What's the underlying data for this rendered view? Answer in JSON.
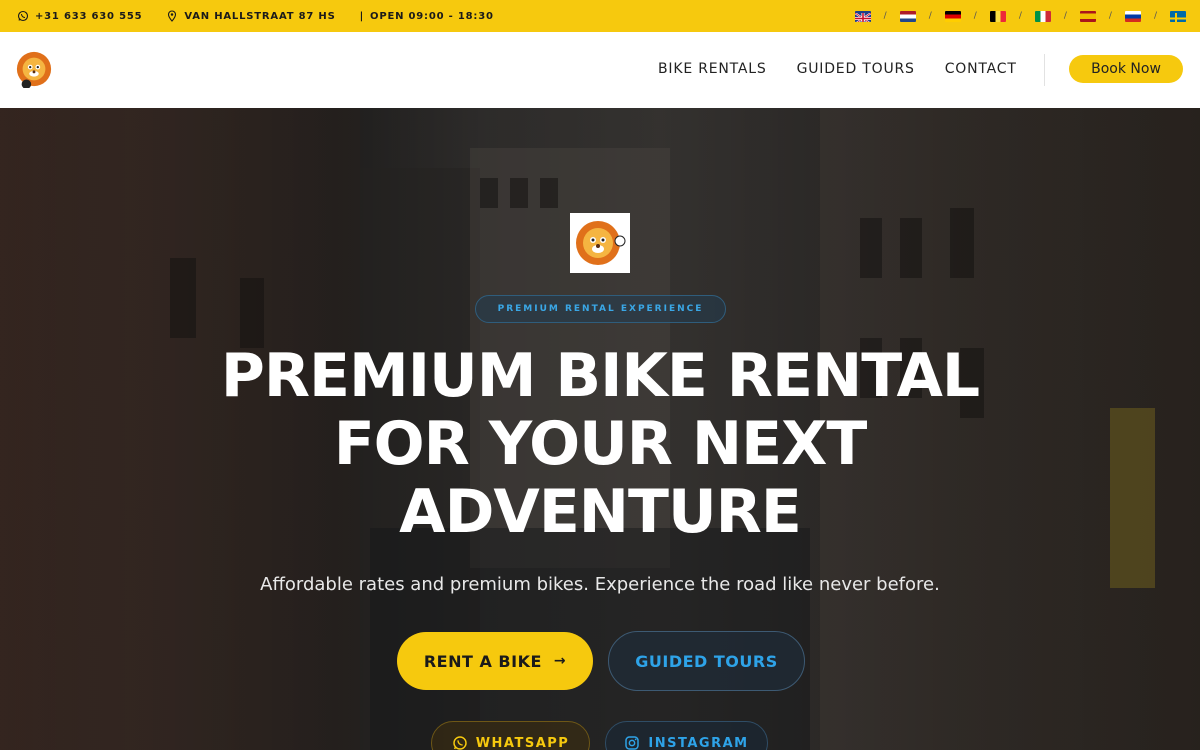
{
  "topbar": {
    "phone": "+31 633 630 555",
    "address": "VAN HALLSTRAAT 87 HS",
    "hours": "OPEN 09:00 - 18:30",
    "hours_sep": "|",
    "flag_sep": "/",
    "flags": [
      "uk-flag-icon",
      "nl-flag-icon",
      "de-flag-icon",
      "be-flag-icon",
      "it-flag-icon",
      "es-flag-icon",
      "ru-flag-icon",
      "se-flag-icon"
    ]
  },
  "nav": {
    "items": [
      "BIKE RENTALS",
      "GUIDED TOURS",
      "CONTACT"
    ],
    "book_label": "Book Now"
  },
  "hero": {
    "badge": "PREMIUM RENTAL EXPERIENCE",
    "headline_line1": "PREMIUM BIKE RENTAL",
    "headline_line2": "FOR YOUR NEXT",
    "headline_line3": "ADVENTURE",
    "subtitle": "Affordable rates and premium bikes. Experience the road like never before.",
    "rent_label": "RENT A BIKE",
    "rent_arrow": "→",
    "tours_label": "GUIDED TOURS",
    "whatsapp_label": "WHATSAPP",
    "instagram_label": "INSTAGRAM"
  },
  "colors": {
    "accent": "#f6c90e",
    "link_blue": "#2ea3e8"
  }
}
